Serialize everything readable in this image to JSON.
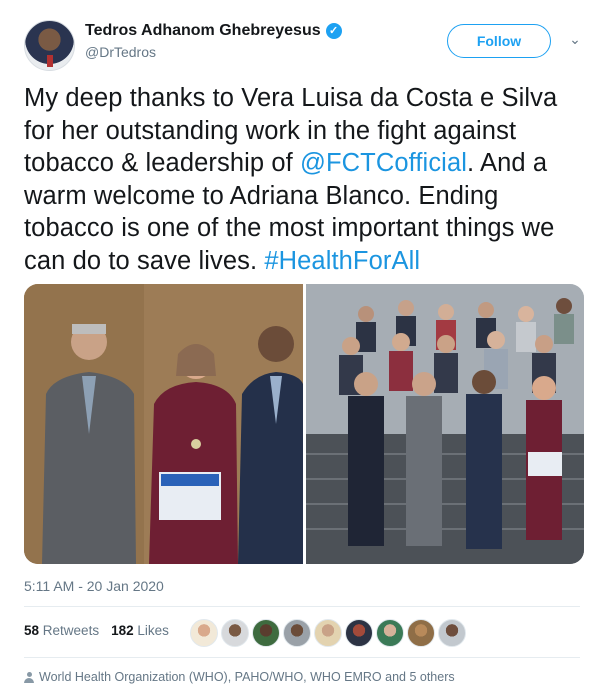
{
  "author": {
    "name": "Tedros Adhanom Ghebreyesus",
    "handle": "@DrTedros",
    "verified_mark": "✓",
    "follow_label": "Follow",
    "menu_glyph": "⌄"
  },
  "tweet": {
    "text_part1": "My deep thanks to Vera Luisa da Costa e Silva for her outstanding work in the fight against tobacco & leadership of ",
    "mention": "@FCTCofficial",
    "text_part2": ". And a warm welcome to Adriana Blanco. Ending tobacco is one of the most important things we can do to save lives. ",
    "hashtag": "#HealthForAll"
  },
  "timestamp": "5:11 AM - 20 Jan 2020",
  "stats": {
    "retweets_count": "58",
    "retweets_label": "Retweets",
    "likes_count": "182",
    "likes_label": "Likes"
  },
  "footer": {
    "text": "World Health Organization (WHO), PAHO/WHO, WHO EMRO and 5 others"
  },
  "colors": {
    "accent": "#1da1f2",
    "link": "#1b95e0",
    "muted": "#657786"
  }
}
